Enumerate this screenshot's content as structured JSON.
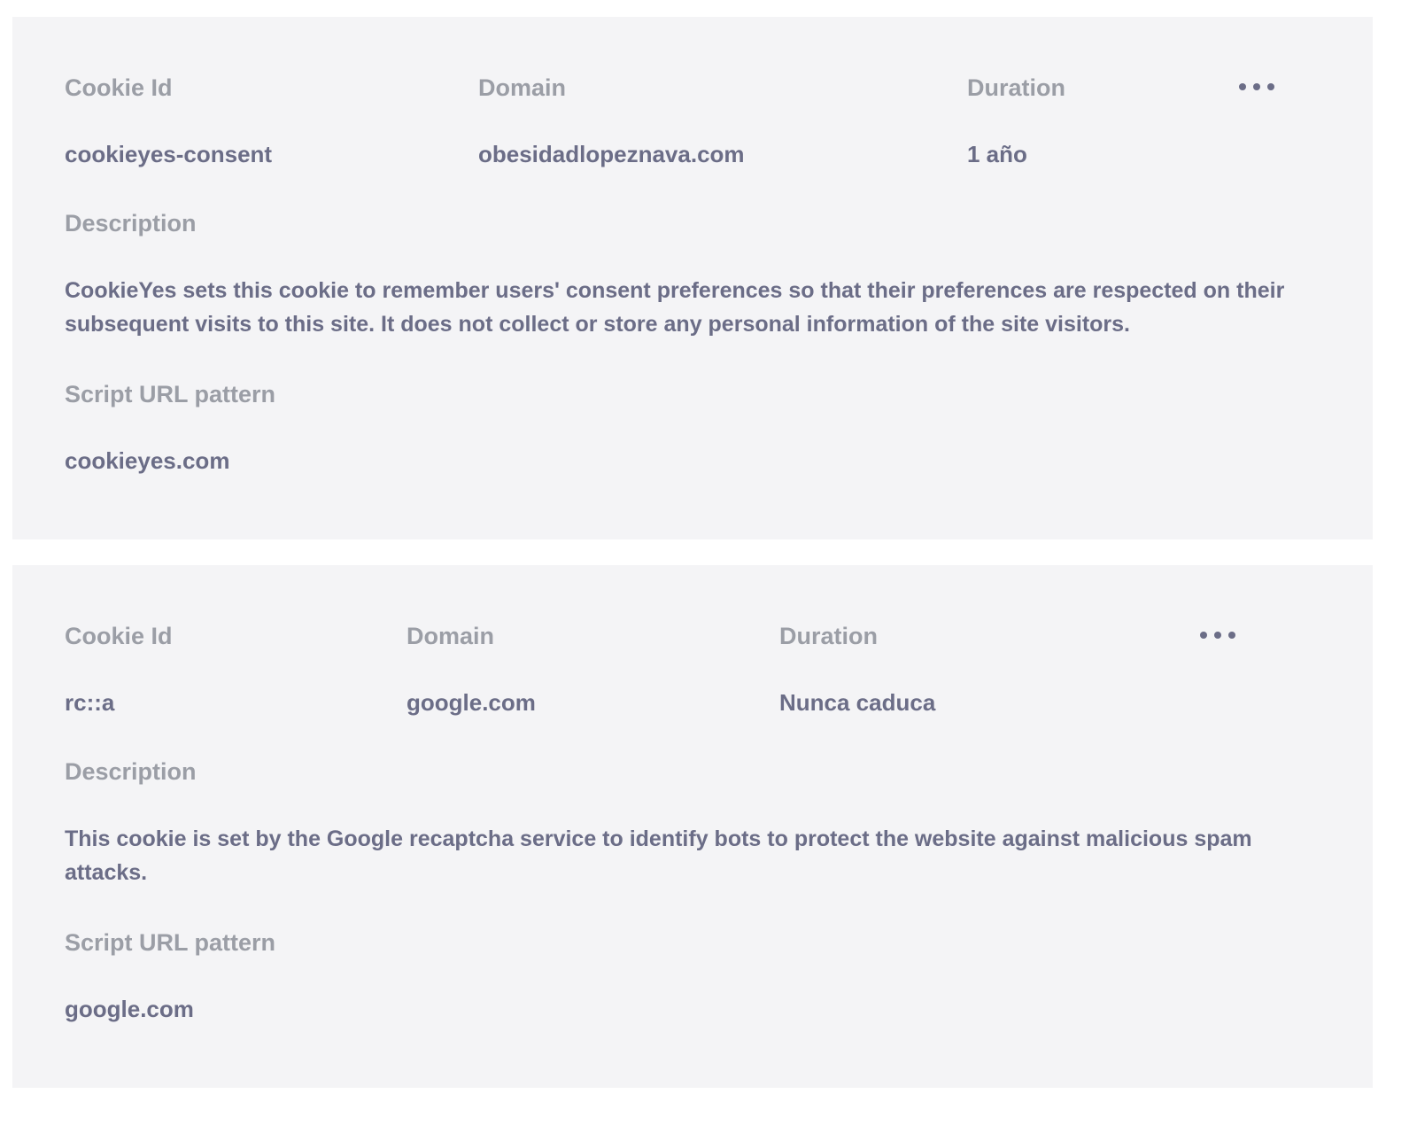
{
  "cookies": [
    {
      "labels": {
        "cookie_id": "Cookie Id",
        "domain": "Domain",
        "duration": "Duration",
        "description": "Description",
        "script_url_pattern": "Script URL pattern"
      },
      "cookie_id": "cookieyes-consent",
      "domain": "obesidadlopeznava.com",
      "duration": "1 año",
      "description": "CookieYes sets this cookie to remember users' consent preferences so that their preferences are respected on their subsequent visits to this site. It does not collect or store any personal information of the site visitors.",
      "script_url_pattern": "cookieyes.com"
    },
    {
      "labels": {
        "cookie_id": "Cookie Id",
        "domain": "Domain",
        "duration": "Duration",
        "description": "Description",
        "script_url_pattern": "Script URL pattern"
      },
      "cookie_id": "rc::a",
      "domain": "google.com",
      "duration": "Nunca caduca",
      "description": "This cookie is set by the Google recaptcha service to identify bots to protect the website against malicious spam attacks.",
      "script_url_pattern": "google.com"
    }
  ],
  "icons": {
    "more": "more-horizontal-icon"
  },
  "colors": {
    "card_background": "#f4f4f6",
    "label_text": "#9b9ea6",
    "value_text": "#6b6d87"
  }
}
